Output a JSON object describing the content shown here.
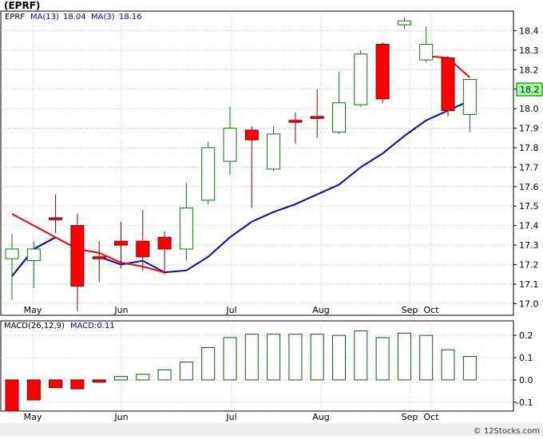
{
  "header": {
    "ticker": "(EPRF)"
  },
  "price_legend": {
    "symbol": "EPRF",
    "ma13_label": "MA(13)",
    "ma13_value": "18.04",
    "ma3_label": "MA(3)",
    "ma3_value": "18.16"
  },
  "macd_legend": {
    "label": "MACD(26,12,9)",
    "value_label": "MACD:0.11"
  },
  "current_price_label": "18.2",
  "watermark": "© 12Stocks.com",
  "colors": {
    "up_candle": "#008000",
    "down_candle": "#ff0000",
    "ma13_line": "#0000cc",
    "ma3_line": "#ff0000",
    "macd_positive": "#006600",
    "macd_negative": "#ff0000",
    "price_tag_bg": "#99ff99",
    "grid": "#c0c0c0",
    "legend_text": "#0000cc"
  },
  "chart_data": [
    {
      "type": "candlestick",
      "title": "(EPRF)",
      "x_ticks": [
        "May",
        "Jun",
        "Jul",
        "Aug",
        "Sep",
        "Oct"
      ],
      "y_ticks": [
        "17.0",
        "17.1",
        "17.2",
        "17.3",
        "17.4",
        "17.5",
        "17.6",
        "17.7",
        "17.8",
        "17.9",
        "18.0",
        "18.1",
        "18.2",
        "18.3",
        "18.4"
      ],
      "ylim": [
        16.94,
        18.5
      ],
      "grid": true,
      "candles": [
        {
          "open": 17.23,
          "high": 17.36,
          "low": 17.02,
          "close": 17.28
        },
        {
          "open": 17.22,
          "high": 17.32,
          "low": 17.08,
          "close": 17.28
        },
        {
          "open": 17.44,
          "high": 17.56,
          "low": 17.36,
          "close": 17.43
        },
        {
          "open": 17.4,
          "high": 17.46,
          "low": 16.96,
          "close": 17.09
        },
        {
          "open": 17.24,
          "high": 17.32,
          "low": 17.11,
          "close": 17.23
        },
        {
          "open": 17.32,
          "high": 17.42,
          "low": 17.18,
          "close": 17.3
        },
        {
          "open": 17.32,
          "high": 17.48,
          "low": 17.17,
          "close": 17.24
        },
        {
          "open": 17.34,
          "high": 17.37,
          "low": 17.15,
          "close": 17.28
        },
        {
          "open": 17.28,
          "high": 17.62,
          "low": 17.22,
          "close": 17.49
        },
        {
          "open": 17.53,
          "high": 17.83,
          "low": 17.51,
          "close": 17.8
        },
        {
          "open": 17.73,
          "high": 18.01,
          "low": 17.66,
          "close": 17.9
        },
        {
          "open": 17.89,
          "high": 17.91,
          "low": 17.49,
          "close": 17.84
        },
        {
          "open": 17.69,
          "high": 17.91,
          "low": 17.68,
          "close": 17.87
        },
        {
          "open": 17.94,
          "high": 17.98,
          "low": 17.82,
          "close": 17.93
        },
        {
          "open": 17.96,
          "high": 18.1,
          "low": 17.85,
          "close": 17.95
        },
        {
          "open": 17.88,
          "high": 18.19,
          "low": 17.87,
          "close": 18.03
        },
        {
          "open": 18.02,
          "high": 18.3,
          "low": 18.01,
          "close": 18.28
        },
        {
          "open": 18.33,
          "high": 18.34,
          "low": 18.03,
          "close": 18.05
        },
        {
          "open": 18.43,
          "high": 18.47,
          "low": 18.41,
          "close": 18.45
        },
        {
          "open": 18.25,
          "high": 18.42,
          "low": 18.24,
          "close": 18.33
        },
        {
          "open": 18.26,
          "high": 18.27,
          "low": 17.96,
          "close": 17.99
        },
        {
          "open": 17.97,
          "high": 18.14,
          "low": 17.88,
          "close": 18.15
        }
      ],
      "series": [
        {
          "name": "MA(13)",
          "values": [
            17.14,
            17.28,
            17.34,
            null,
            17.24,
            17.2,
            17.22,
            17.16,
            17.17,
            17.24,
            17.34,
            17.42,
            17.47,
            17.51,
            17.56,
            17.61,
            17.7,
            17.77,
            17.86,
            17.94,
            17.99,
            18.04
          ]
        },
        {
          "name": "MA(3)",
          "values": [
            17.46,
            17.4,
            17.34,
            17.28,
            17.26,
            17.21,
            17.19,
            17.16,
            null,
            null,
            null,
            null,
            null,
            null,
            null,
            null,
            null,
            null,
            null,
            18.27,
            18.26,
            18.16
          ]
        }
      ]
    },
    {
      "type": "bar",
      "title": "MACD(26,12,9)",
      "x_ticks": [
        "May",
        "Jun",
        "Jul",
        "Aug",
        "Sep",
        "Oct"
      ],
      "y_ticks": [
        "-0.1",
        "0.0",
        "0.1",
        "0.2"
      ],
      "ylim": [
        -0.14,
        0.265
      ],
      "values": [
        -0.14,
        -0.09,
        -0.035,
        -0.04,
        -0.01,
        0.015,
        0.025,
        0.045,
        0.08,
        0.145,
        0.19,
        0.205,
        0.205,
        0.205,
        0.205,
        0.2,
        0.22,
        0.19,
        0.21,
        0.2,
        0.135,
        0.105
      ]
    }
  ]
}
